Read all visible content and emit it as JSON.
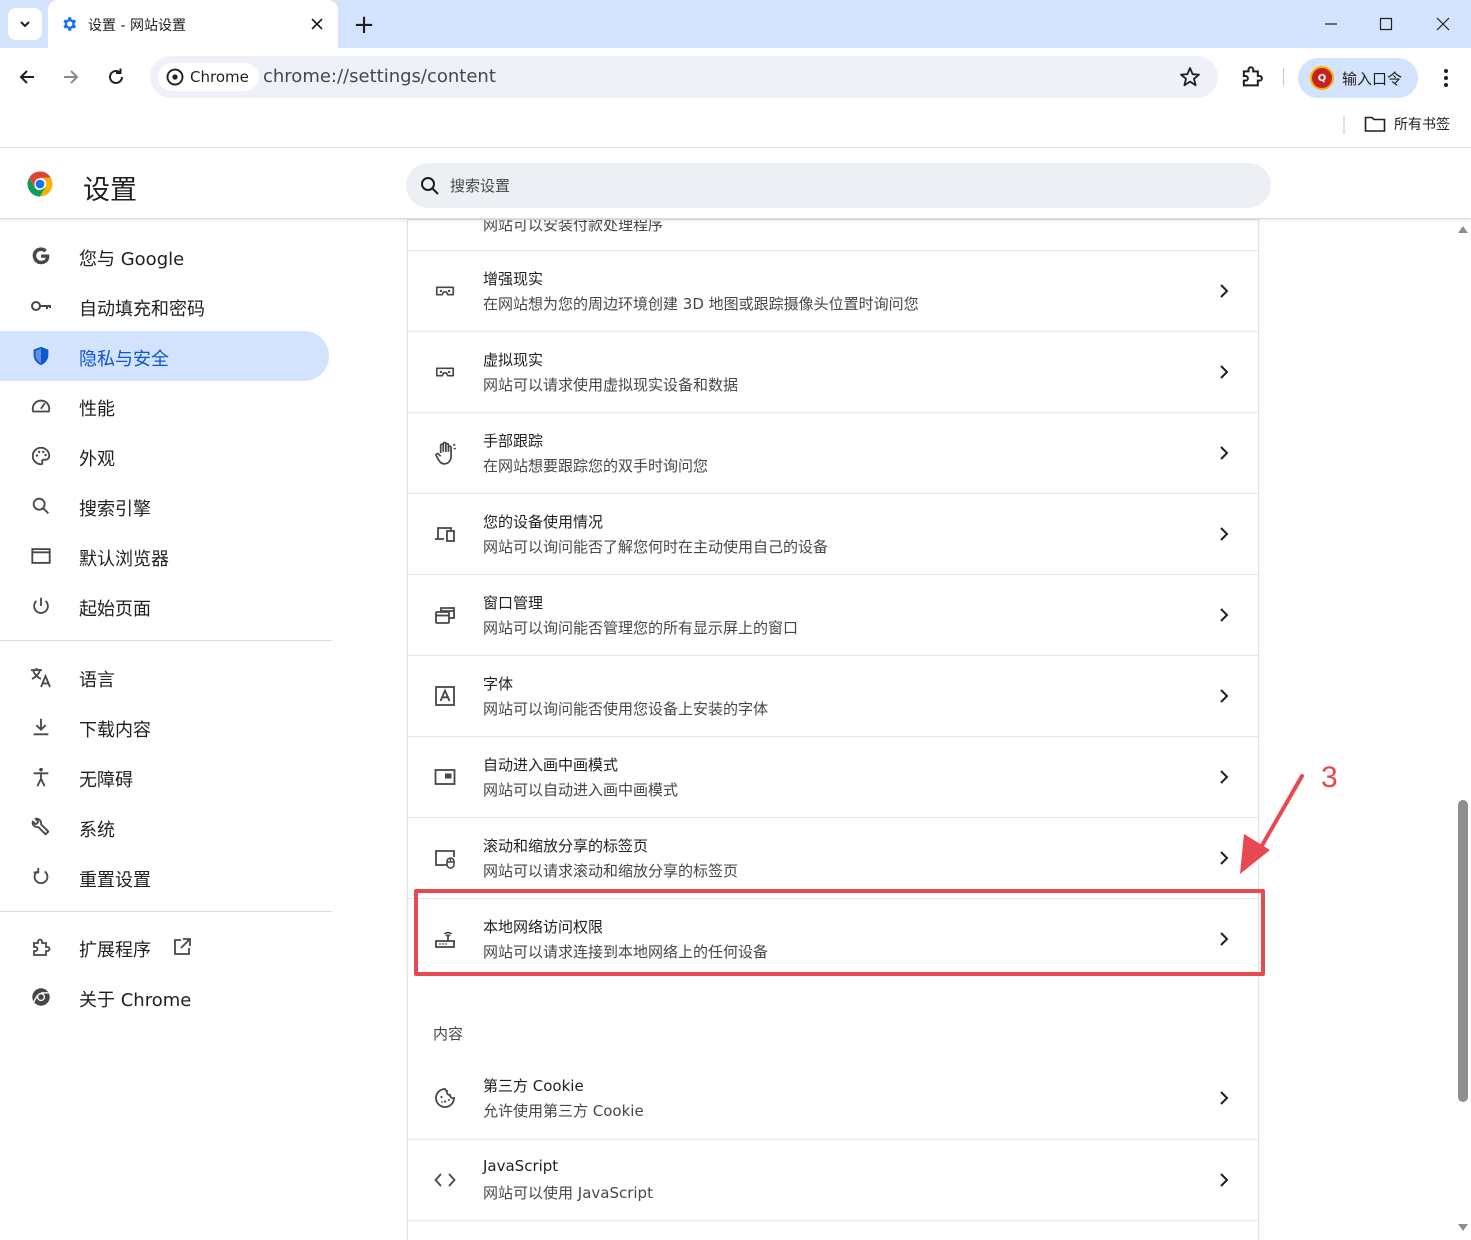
{
  "browser": {
    "tab_title": "设置 - 网站设置",
    "new_tab_symbol": "+",
    "chip_label": "Chrome",
    "url": "chrome://settings/content",
    "profile_label": "输入口令",
    "avatar_letter": "Q",
    "all_bookmarks": "所有书签"
  },
  "header": {
    "title": "设置",
    "search_placeholder": "搜索设置"
  },
  "sidebar": {
    "items": [
      {
        "label": "您与 Google",
        "icon": "google-icon",
        "active": false
      },
      {
        "label": "自动填充和密码",
        "icon": "key-icon",
        "active": false
      },
      {
        "label": "隐私与安全",
        "icon": "shield-icon",
        "active": true
      },
      {
        "label": "性能",
        "icon": "speedometer-icon",
        "active": false
      },
      {
        "label": "外观",
        "icon": "palette-icon",
        "active": false
      },
      {
        "label": "搜索引擎",
        "icon": "search-icon",
        "active": false
      },
      {
        "label": "默认浏览器",
        "icon": "browser-window-icon",
        "active": false
      },
      {
        "label": "起始页面",
        "icon": "power-icon",
        "active": false
      },
      {
        "label": "语言",
        "icon": "translate-icon",
        "active": false
      },
      {
        "label": "下载内容",
        "icon": "download-icon",
        "active": false
      },
      {
        "label": "无障碍",
        "icon": "accessibility-icon",
        "active": false
      },
      {
        "label": "系统",
        "icon": "wrench-icon",
        "active": false
      },
      {
        "label": "重置设置",
        "icon": "reset-icon",
        "active": false
      },
      {
        "label": "扩展程序",
        "icon": "puzzle-icon",
        "active": false
      },
      {
        "label": "关于 Chrome",
        "icon": "chrome-icon",
        "active": false
      }
    ]
  },
  "content": {
    "clipped_desc": "网站可以安装付款处理程序",
    "rows": [
      {
        "title": "增强现实",
        "desc": "在网站想为您的周边环境创建 3D 地图或跟踪摄像头位置时询问您",
        "icon": "vr-headset-icon"
      },
      {
        "title": "虚拟现实",
        "desc": "网站可以请求使用虚拟现实设备和数据",
        "icon": "vr-headset-icon"
      },
      {
        "title": "手部跟踪",
        "desc": "在网站想要跟踪您的双手时询问您",
        "icon": "hand-icon"
      },
      {
        "title": "您的设备使用情况",
        "desc": "网站可以询问能否了解您何时在主动使用自己的设备",
        "icon": "devices-icon"
      },
      {
        "title": "窗口管理",
        "desc": "网站可以询问能否管理您的所有显示屏上的窗口",
        "icon": "window-management-icon"
      },
      {
        "title": "字体",
        "desc": "网站可以询问能否使用您设备上安装的字体",
        "icon": "font-icon"
      },
      {
        "title": "自动进入画中画模式",
        "desc": "网站可以自动进入画中画模式",
        "icon": "picture-in-picture-icon"
      },
      {
        "title": "滚动和缩放分享的标签页",
        "desc": "网站可以请求滚动和缩放分享的标签页",
        "icon": "tab-scroll-zoom-icon"
      },
      {
        "title": "本地网络访问权限",
        "desc": "网站可以请求连接到本地网络上的任何设备",
        "icon": "router-icon"
      }
    ],
    "section_label": "内容",
    "rows2": [
      {
        "title": "第三方 Cookie",
        "desc": "允许使用第三方 Cookie",
        "icon": "cookie-icon"
      },
      {
        "title": "JavaScript",
        "desc": "网站可以使用 JavaScript",
        "icon": "code-icon"
      }
    ]
  },
  "annotation": {
    "step": "3",
    "color": "#e8484f"
  },
  "colors": {
    "tabstrip": "#d3e3fd",
    "active_nav_bg": "#d3e3fd",
    "active_nav_text": "#0b57d0"
  }
}
